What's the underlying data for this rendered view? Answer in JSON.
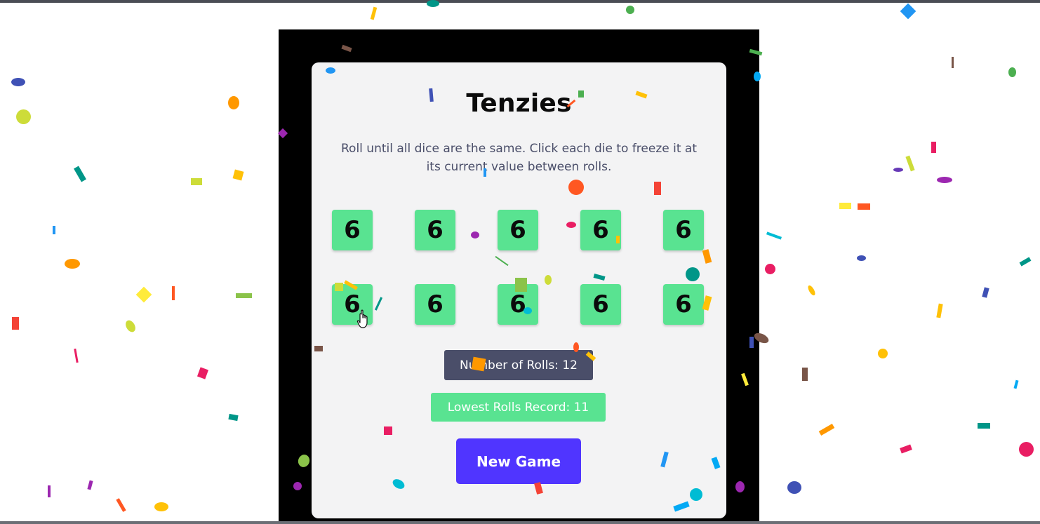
{
  "game": {
    "title": "Tenzies",
    "instructions": "Roll until all dice are the same. Click each die to freeze it at its current value between rolls.",
    "dice": [
      "6",
      "6",
      "6",
      "6",
      "6",
      "6",
      "6",
      "6",
      "6",
      "6"
    ],
    "rolls_label": "Number of Rolls: 12",
    "record_label": "Lowest Rolls Record: 11",
    "new_game_label": "New Game"
  },
  "colors": {
    "die_held": "#59e391",
    "rolls_badge": "#4a4e69",
    "new_game_button": "#5035ff",
    "card_background": "#f3f3f4"
  },
  "icons": {
    "cursor": "hand-pointer-icon"
  }
}
